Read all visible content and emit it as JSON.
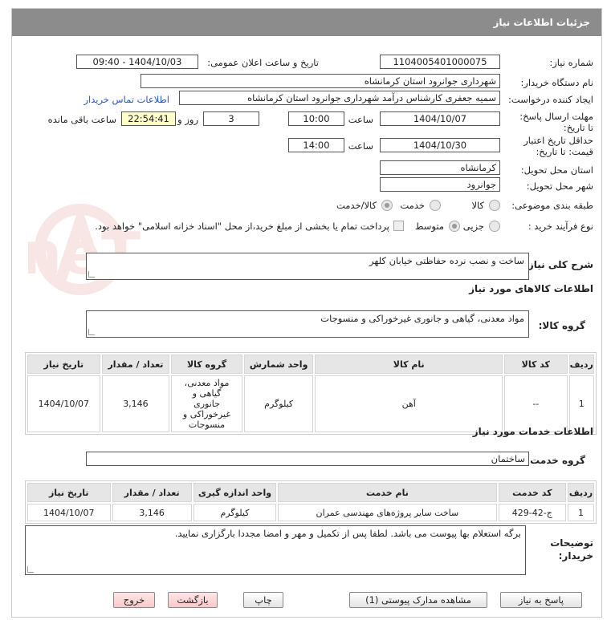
{
  "header": {
    "title": "جزئیات اطلاعات نیاز"
  },
  "fields": {
    "need_number_label": "شماره نیاز:",
    "need_number": "1104005401000075",
    "announce_label": "تاریخ و ساعت اعلان عمومی:",
    "announce_value": "1404/10/03 - 09:40",
    "buyer_org_label": "نام دستگاه خریدار:",
    "buyer_org": "شهرداری جوانرود استان کرمانشاه",
    "creator_label": "ایجاد کننده درخواست:",
    "creator": "سمیه جعفری کارشناس درآمد شهرداری جوانرود استان کرمانشاه",
    "contact_link": "اطلاعات تماس خریدار",
    "deadline_label": "مهلت ارسال پاسخ: تا تاریخ:",
    "deadline_date": "1404/10/07",
    "time_label": "ساعت",
    "deadline_time": "10:00",
    "days": "3",
    "days_label": "روز و",
    "remaining": "22:54:41",
    "remaining_label": "ساعت باقی مانده",
    "validity_label": "حداقل تاریخ اعتبار قیمت: تا تاریخ:",
    "validity_date": "1404/10/30",
    "validity_time": "14:00",
    "province_label": "استان محل تحویل:",
    "province": "کرمانشاه",
    "city_label": "شهر محل تحویل:",
    "city": "جوانرود",
    "category_label": "طبقه بندی موضوعی:",
    "cat_goods": "کالا",
    "cat_service": "خدمت",
    "cat_both": "کالا/خدمت",
    "process_label": "نوع فرآیند خرید :",
    "proc_minor": "جزیی",
    "proc_medium": "متوسط",
    "payment_note": "پرداخت تمام یا بخشی از مبلغ خرید،از محل \"اسناد خزانه اسلامی\" خواهد بود."
  },
  "summary": {
    "label": "شرح کلی نیاز:",
    "value": "ساخت و نصب نرده حفاظتی خیابان کلهر"
  },
  "goods": {
    "section_title": "اطلاعات کالاهای مورد نیاز",
    "group_label": "گروه کالا:",
    "group_value": "مواد معدنی، گیاهی و جانوری غیرخوراکی و منسوجات",
    "headers": [
      "ردیف",
      "کد کالا",
      "نام کالا",
      "واحد شمارش",
      "گروه کالا",
      "تعداد / مقدار",
      "تاریخ نیاز"
    ],
    "row": {
      "idx": "1",
      "code": "--",
      "name": "آهن",
      "unit": "کیلوگرم",
      "group": "مواد معدنی، گیاهی و جانوری غیرخوراکی و منسوجات",
      "qty": "3,146",
      "date": "1404/10/07"
    }
  },
  "services": {
    "section_title": "اطلاعات خدمات مورد نیاز",
    "group_label": "گروه خدمت:",
    "group_value": "ساختمان",
    "headers": [
      "ردیف",
      "کد خدمت",
      "نام خدمت",
      "واحد اندازه گیری",
      "تعداد / مقدار",
      "تاریخ نیاز"
    ],
    "row": {
      "idx": "1",
      "code": "ج-42-429",
      "name": "ساخت سایر پروژه‌های مهندسی عمران",
      "unit": "کیلوگرم",
      "qty": "3,146",
      "date": "1404/10/07"
    }
  },
  "notes": {
    "label": "توضیحات خریدار:",
    "value": "برگه استعلام بها پیوست می باشد. لطفا پس از تکمیل و مهر و امضا مجددا بارگزاری نمایید."
  },
  "buttons": {
    "reply": "پاسخ به نیاز",
    "attachments": "مشاهده مدارک پیوستی (1)",
    "print": "چاپ",
    "back": "بازگشت",
    "exit": "خروج"
  },
  "watermark": {
    "text": "AriaTender.neT"
  }
}
